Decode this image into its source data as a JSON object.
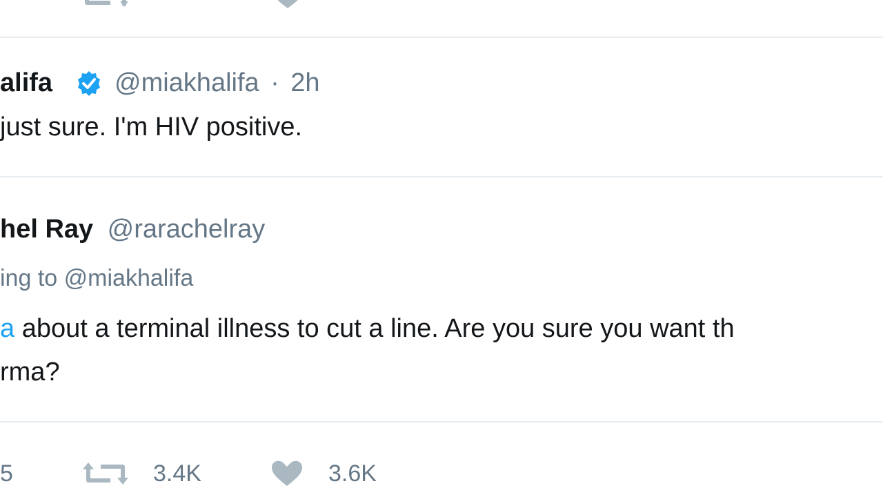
{
  "top_tweet": {
    "retweet_icon": "retweet-icon",
    "like_icon": "heart-icon",
    "retweet_count": "",
    "like_count": ""
  },
  "tweet1": {
    "name": "alifa",
    "verified_icon": "verified-badge-icon",
    "handle": "@miakhalifa",
    "separator": "·",
    "time": "2h",
    "text": "just sure. I'm HIV positive."
  },
  "tweet2": {
    "name": "hel Ray",
    "handle": "@rarachelray",
    "reply_prefix": "ing to",
    "reply_to": "@miakhalifa",
    "mention_fragment": "a",
    "text_line1": " about a terminal illness to cut a line. Are you sure you want th",
    "text_line2": "rma?",
    "reply_count": "5",
    "retweet_count": "3.4K",
    "like_count": "3.6K",
    "retweet_icon": "retweet-icon",
    "like_icon": "heart-icon"
  },
  "colors": {
    "link": "#1da1f2",
    "muted": "#657786",
    "icon": "#aab8c2",
    "divider": "#e6ecf0"
  }
}
